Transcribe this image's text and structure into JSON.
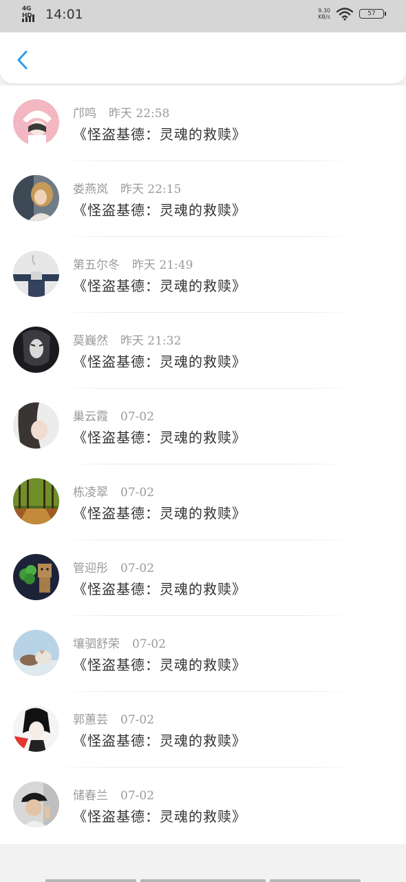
{
  "status_bar": {
    "network": "4G HD",
    "time": "14:01",
    "speed_value": "9.30",
    "speed_unit": "KB/s",
    "battery": "57"
  },
  "header": {
    "back_icon": "chevron-left-icon"
  },
  "comments": [
    {
      "name": "邝鸣",
      "time": "昨天 22:58",
      "text": "《怪盗基德：灵魂的救赎》"
    },
    {
      "name": "娄燕岚",
      "time": "昨天 22:15",
      "text": "《怪盗基德：灵魂的救赎》"
    },
    {
      "name": "第五尔冬",
      "time": "昨天 21:49",
      "text": "《怪盗基德：灵魂的救赎》"
    },
    {
      "name": "莫巍然",
      "time": "昨天 21:32",
      "text": "《怪盗基德：灵魂的救赎》"
    },
    {
      "name": "巢云霞",
      "time": "07-02",
      "text": "《怪盗基德：灵魂的救赎》"
    },
    {
      "name": "栋凌翠",
      "time": "07-02",
      "text": "《怪盗基德：灵魂的救赎》"
    },
    {
      "name": "管迎彤",
      "time": "07-02",
      "text": "《怪盗基德：灵魂的救赎》"
    },
    {
      "name": "壤驷舒荣",
      "time": "07-02",
      "text": "《怪盗基德：灵魂的救赎》"
    },
    {
      "name": "郭蕙芸",
      "time": "07-02",
      "text": "《怪盗基德：灵魂的救赎》"
    },
    {
      "name": "储春兰",
      "time": "07-02",
      "text": "《怪盗基德：灵魂的救赎》"
    }
  ],
  "colors": {
    "accent": "#2a9cf0",
    "status_bar": "#d6d6d6",
    "meta": "#9a9a9a"
  }
}
